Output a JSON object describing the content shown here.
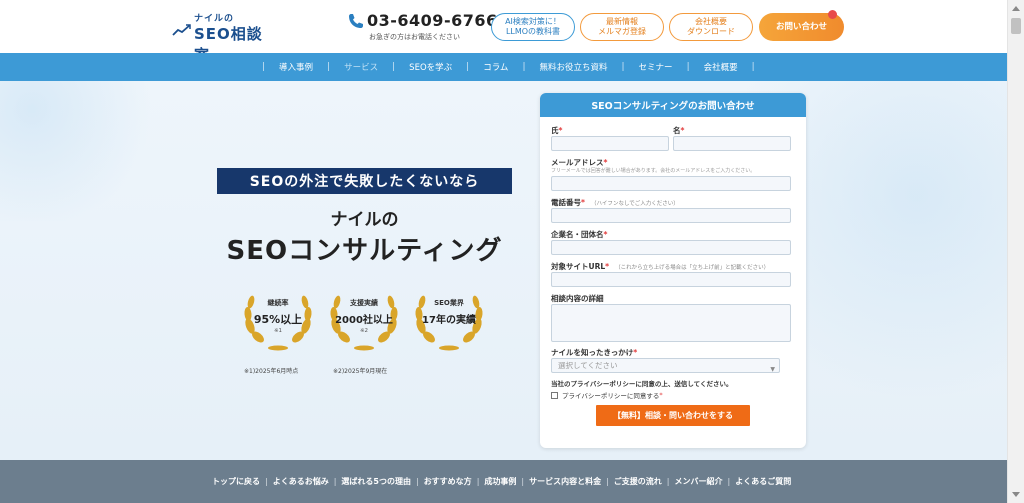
{
  "header": {
    "logo_small": "ナイルの",
    "logo_main": "SEO相談室",
    "phone_number": "03-6409-6766",
    "phone_note": "お急ぎの方はお電話ください",
    "buttons": [
      {
        "line1": "AI検索対策に！",
        "line2": "LLMOの教科書"
      },
      {
        "line1": "最新情報",
        "line2": "メルマガ登録"
      },
      {
        "line1": "会社概要",
        "line2": "ダウンロード"
      },
      {
        "line1": "お問い合わせ",
        "line2": ""
      }
    ]
  },
  "nav": {
    "items": [
      "導入事例",
      "サービス",
      "SEOを学ぶ",
      "コラム",
      "無料お役立ち資料",
      "セミナー",
      "会社概要"
    ]
  },
  "hero": {
    "tagline": "SEOの外注で失敗したくないなら",
    "headline1": "ナイルの",
    "headline2": "SEOコンサルティング",
    "badges": [
      {
        "title": "継続率",
        "value": "95%以上",
        "note": "※1"
      },
      {
        "title": "支援実績",
        "value": "2000社以上",
        "note": "※2"
      },
      {
        "title": "SEO業界",
        "value": "17年の実績",
        "note": ""
      }
    ],
    "footnotes": [
      "※1)2025年6月時点",
      "※2)2025年9月現在"
    ]
  },
  "form": {
    "title": "SEOコンサルティングのお問い合わせ",
    "last_name": "氏",
    "first_name": "名",
    "email": "メールアドレス",
    "email_hint": "フリーメールでは回答が難しい場合があります。会社のメールアドレスをご入力ください。",
    "phone": "電話番号",
    "phone_hint": "（ハイフンなしでご入力ください）",
    "company": "企業名・団体名",
    "url": "対象サイトURL",
    "url_hint": "（これから立ち上げる場合は「立ち上げ前」と記載ください）",
    "details": "相談内容の詳細",
    "source": "ナイルを知ったきっかけ",
    "select_placeholder": "選択してください",
    "agree_text": "当社のプライバシーポリシーに同意の上、送信してください。",
    "checkbox_label": "プライバシーポリシーに同意する",
    "required_mark": "*",
    "submit": "【無料】相談・問い合わせをする"
  },
  "footer": {
    "items": [
      "トップに戻る",
      "よくあるお悩み",
      "選ばれる5つの理由",
      "おすすめな方",
      "成功事例",
      "サービス内容と料金",
      "ご支援の流れ",
      "メンバー紹介",
      "よくあるご質問"
    ]
  },
  "colors": {
    "nav_blue": "#3d9ad6",
    "navy": "#17376b",
    "cta_orange": "#ef6b16",
    "footer_gray": "#6c7e8e",
    "gold": "#d9a52a"
  }
}
